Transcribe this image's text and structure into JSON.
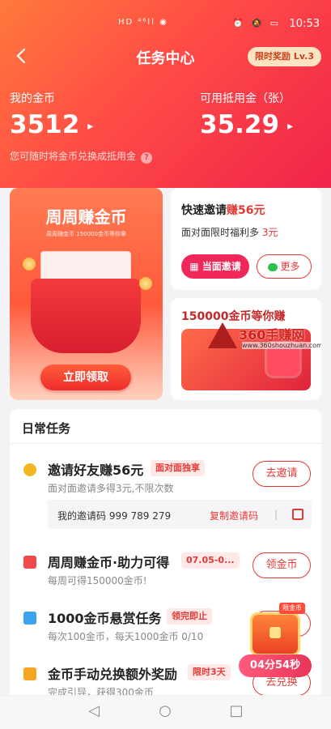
{
  "status_bar": {
    "signal": "HD ⁴⁶ll ◉",
    "right_icons": "⏰ 🔕 ▭",
    "time": "10:53"
  },
  "header": {
    "title": "任务中心",
    "badge": "限时奖励 Lv.3"
  },
  "wallet": {
    "coins_label": "我的金币",
    "coins_value": "3512",
    "voucher_label": "可用抵用金（张）",
    "voucher_value": "35.29",
    "hint": "您可随时将金币兑换成抵用金"
  },
  "promo_left": {
    "title": "周周赚金币",
    "subtitle": "周周赚金币 150000金币等你拿",
    "cta": "立即领取"
  },
  "promo_invite": {
    "title_prefix": "快速邀请",
    "title_highlight": "赚56元",
    "desc_prefix": "面对面限时福利多",
    "desc_amount": "3元",
    "face_button": "当面邀请",
    "more_button": "更多"
  },
  "promo_coins": {
    "title": "150000金币等你赚"
  },
  "watermark": {
    "brand": "360手赚网",
    "url": "www.360shouzhuan.com"
  },
  "daily": {
    "title": "日常任务",
    "tasks": [
      {
        "name": "邀请好友赚56元",
        "tag": "面对面独享",
        "desc": "面对面邀请多得3元,不限次数",
        "button": "去邀请",
        "icon": "coin-icon",
        "color": "#f5b623"
      },
      {
        "name": "周周赚金币·助力可得",
        "tag": "07.05-0...",
        "desc": "每周可得150000金币!",
        "button": "领金币",
        "icon": "wallet-icon",
        "color": "#f04b4b"
      },
      {
        "name": "1000金币悬赏任务",
        "tag": "领完即止",
        "desc": "每次100金币，每天1000金币 0/10",
        "button": "去完成",
        "icon": "tv-icon",
        "color": "#3aa4f0"
      },
      {
        "name": "金币手动兑换额外奖励",
        "tag": "限时3天",
        "desc": "完成引导，获得300金币",
        "button": "去兑换",
        "icon": "book-icon",
        "color": "#f5a623"
      }
    ],
    "invite_code_label": "我的邀请码 999 789 279",
    "copy_label": "复制邀请码",
    "divider": "|"
  },
  "floater": {
    "chip": "限金币",
    "timer": "04分54秒"
  },
  "nav": {
    "back": "◁",
    "home": "○",
    "recent": "□"
  }
}
